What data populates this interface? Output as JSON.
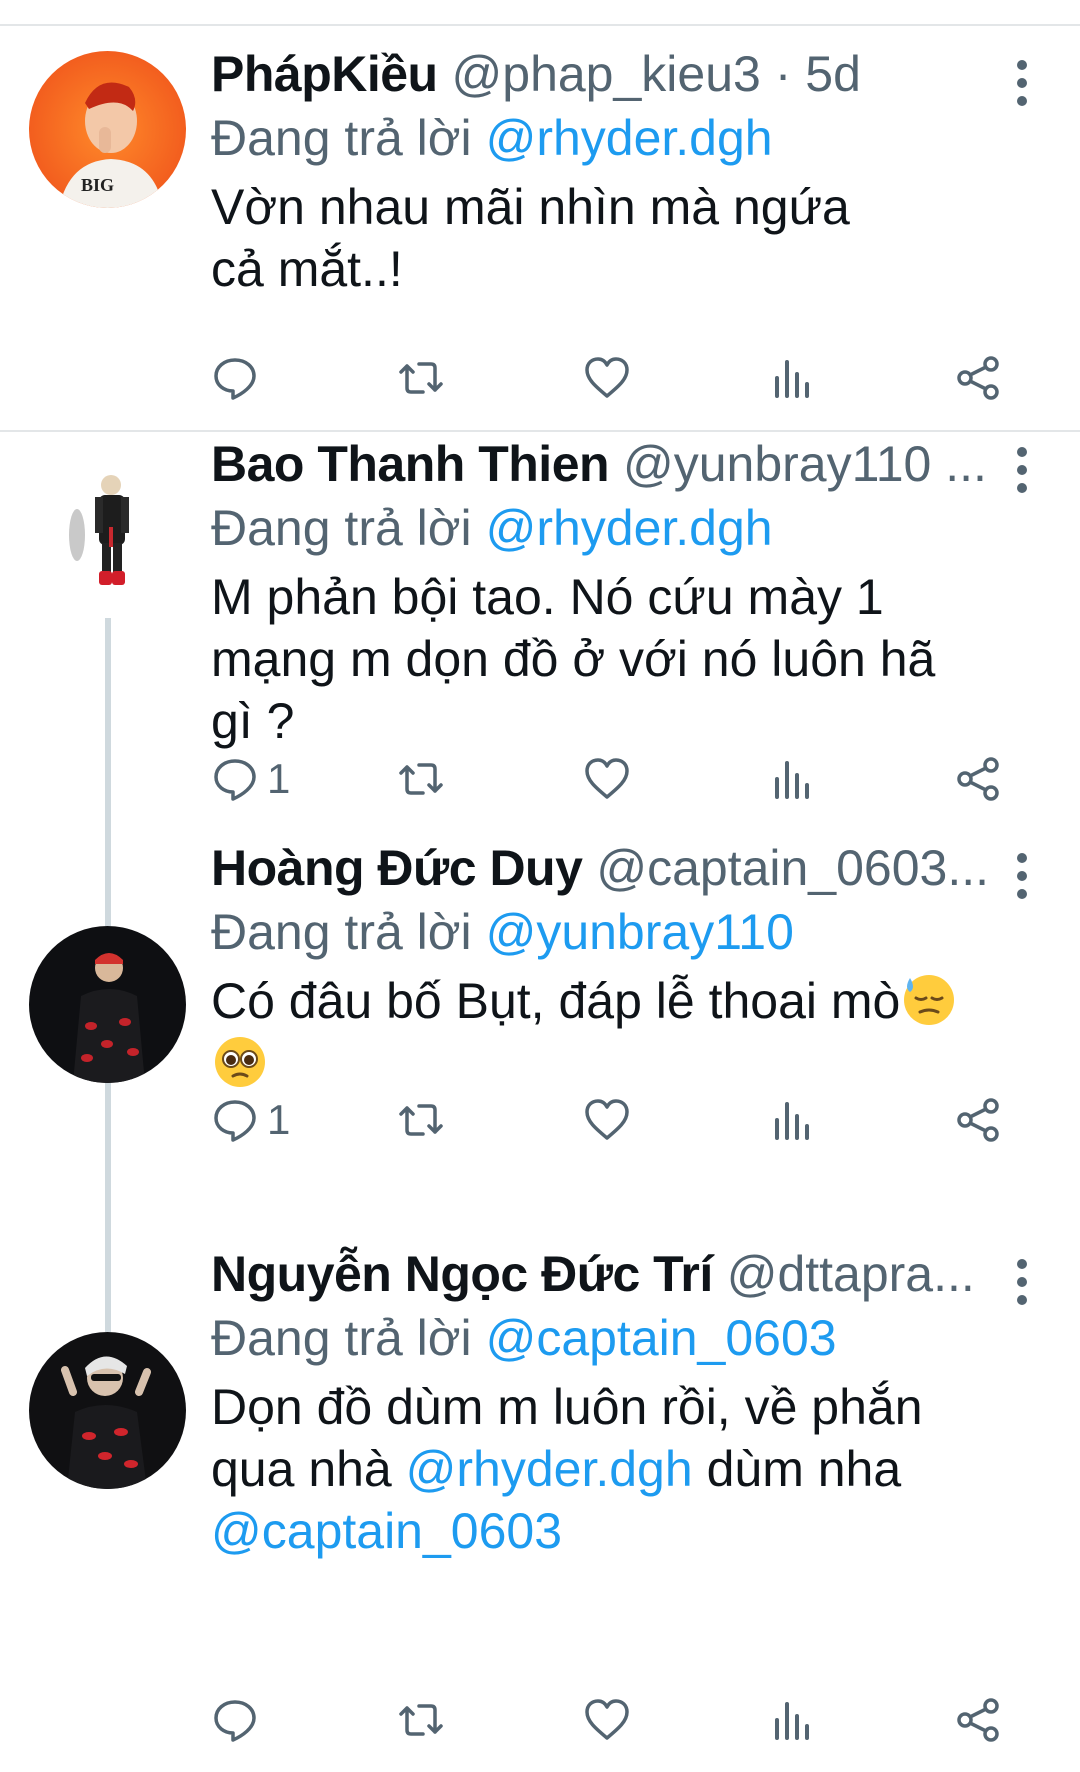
{
  "tweets": [
    {
      "name": "PhápKiều",
      "handle": "@phap_kieu3",
      "separator": " · ",
      "time": "5d",
      "reply_prefix": "Đang trả lời ",
      "reply_to": "@rhyder.dgh",
      "text": "Vờn nhau mãi nhìn mà ngứa cả mắt..!",
      "reply_count": ""
    },
    {
      "name": "Bao Thanh Thien",
      "handle": "@yunbray110 ...",
      "reply_prefix": "Đang trả lời ",
      "reply_to": "@rhyder.dgh",
      "text": "M phản bội tao. Nó cứu mày 1 mạng m dọn đồ ở với nó luôn hã gì ?",
      "reply_count": "1"
    },
    {
      "name": "Hoàng Đức Duy",
      "handle": "@captain_0603...",
      "reply_prefix": "Đang trả lời ",
      "reply_to": "@yunbray110",
      "text": "Có đâu bố Bụt, đáp lễ thoai mò",
      "reply_count": "1"
    },
    {
      "name": "Nguyễn Ngọc Đức Trí",
      "handle": "@dttapra...",
      "reply_prefix": "Đang trả lời ",
      "reply_to": "@captain_0603",
      "text_part1": "Dọn đồ dùm m luôn rồi, về phắn qua nhà ",
      "text_mention1": "@rhyder.dgh",
      "text_part2": " dùm nha ",
      "text_mention2": "@captain_0603",
      "reply_count": ""
    }
  ],
  "icons": {
    "reply": "reply-icon",
    "retweet": "retweet-icon",
    "like": "like-icon",
    "views": "views-icon",
    "share": "share-icon",
    "more": "more-vertical-icon"
  },
  "colors": {
    "link": "#1d9bf0",
    "secondary_text": "#536471",
    "primary_text": "#0f1419",
    "thread_line": "#cfd9de"
  }
}
